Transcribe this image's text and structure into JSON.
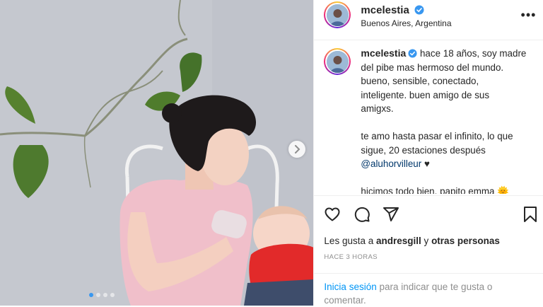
{
  "post": {
    "username": "mcelestia",
    "location": "Buenos Aires, Argentina",
    "verified": true,
    "carousel": {
      "slides": 4,
      "active_index": 0
    }
  },
  "caption": {
    "lines_1": [
      "hace 18 años, soy madre",
      "del pibe mas hermoso del mundo.",
      "bueno, sensible, conectado,",
      "inteligente. buen amigo de sus",
      "amigxs."
    ],
    "lines_2": [
      "te amo hasta pasar el infinito, lo que",
      "sigue, 20 estaciones después"
    ],
    "mention": "@aluhorvilleur",
    "heart": "♥",
    "line_3": "hicimos todo bien, papito emma",
    "emoji": "🌞"
  },
  "likes": {
    "prefix": "Les gusta a",
    "user": "andresgill",
    "joiner": "y",
    "others": "otras personas"
  },
  "timestamp": "HACE 3 HORAS",
  "login": {
    "link": "Inicia sesión",
    "rest": "para indicar que te gusta o comentar."
  },
  "icons": {
    "more": "more-options-icon",
    "like": "heart-icon",
    "comment": "comment-icon",
    "share": "share-icon",
    "save": "bookmark-icon",
    "next": "chevron-right-icon"
  },
  "colors": {
    "verified": "#3897f0",
    "link": "#0095f6",
    "mention": "#00376b",
    "muted": "#8e8e8e"
  }
}
